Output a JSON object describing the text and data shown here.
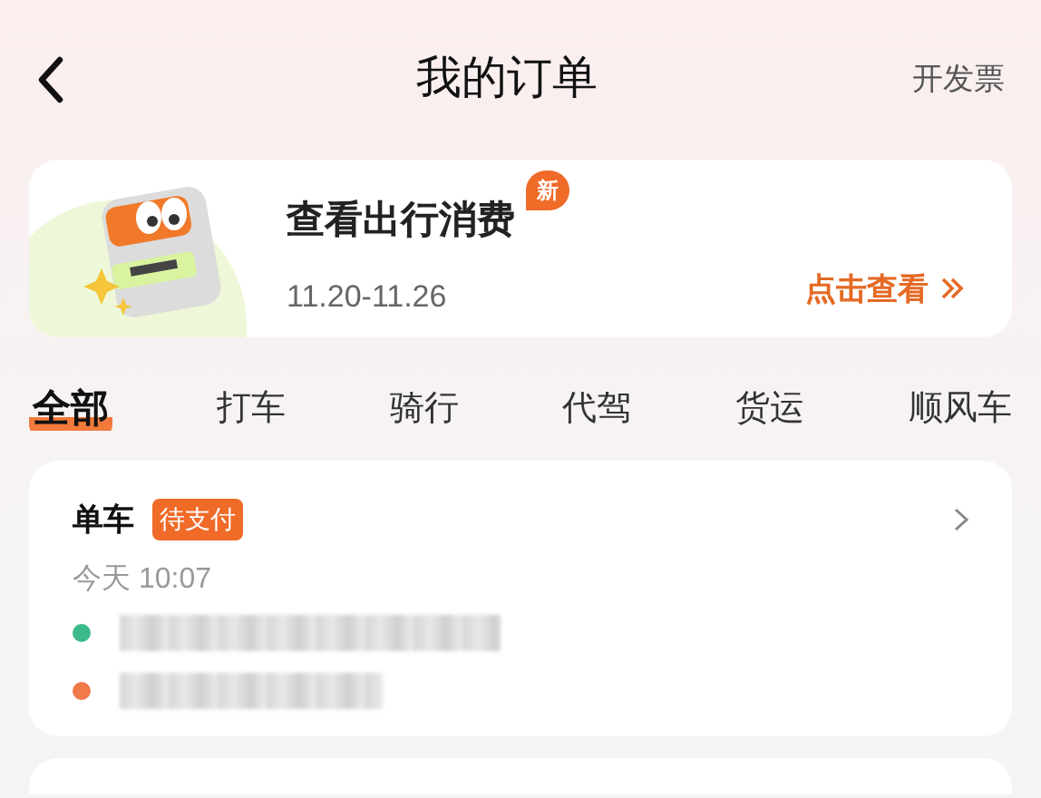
{
  "header": {
    "title": "我的订单",
    "action": "开发票"
  },
  "banner": {
    "title": "查看出行消费",
    "badge": "新",
    "dates": "11.20-11.26",
    "link": "点击查看"
  },
  "tabs": [
    {
      "label": "全部",
      "selected": true
    },
    {
      "label": "打车",
      "selected": false
    },
    {
      "label": "骑行",
      "selected": false
    },
    {
      "label": "代驾",
      "selected": false
    },
    {
      "label": "货运",
      "selected": false
    },
    {
      "label": "顺风车",
      "selected": false
    }
  ],
  "orders": [
    {
      "type": "单车",
      "status": "待支付",
      "time": "今天 10:07",
      "stops": [
        {
          "color": "#3dba8a"
        },
        {
          "color": "#f07a4a"
        }
      ]
    }
  ]
}
